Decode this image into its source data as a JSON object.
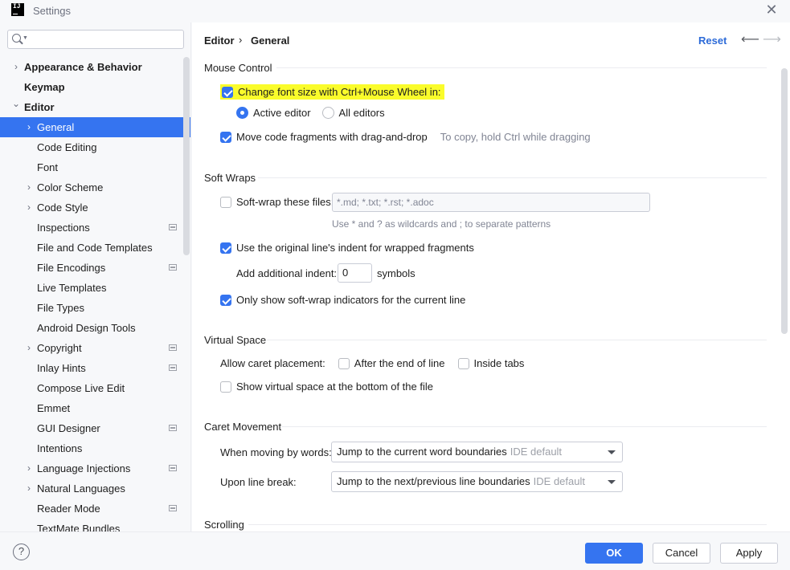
{
  "window": {
    "title": "Settings",
    "logo_text": "IJ"
  },
  "sidebar": {
    "search": {
      "placeholder": ""
    },
    "items": [
      {
        "label": "Appearance & Behavior",
        "expandable": true,
        "bold": true
      },
      {
        "label": "Keymap",
        "bold": true
      },
      {
        "label": "Editor",
        "expanded": true,
        "bold": true
      },
      {
        "label": "General",
        "expandable": true,
        "selected": true
      },
      {
        "label": "Code Editing"
      },
      {
        "label": "Font"
      },
      {
        "label": "Color Scheme",
        "expandable": true
      },
      {
        "label": "Code Style",
        "expandable": true
      },
      {
        "label": "Inspections",
        "project_icon": true
      },
      {
        "label": "File and Code Templates"
      },
      {
        "label": "File Encodings",
        "project_icon": true
      },
      {
        "label": "Live Templates"
      },
      {
        "label": "File Types"
      },
      {
        "label": "Android Design Tools"
      },
      {
        "label": "Copyright",
        "expandable": true,
        "project_icon": true
      },
      {
        "label": "Inlay Hints",
        "project_icon": true
      },
      {
        "label": "Compose Live Edit"
      },
      {
        "label": "Emmet"
      },
      {
        "label": "GUI Designer",
        "project_icon": true
      },
      {
        "label": "Intentions"
      },
      {
        "label": "Language Injections",
        "expandable": true,
        "project_icon": true
      },
      {
        "label": "Natural Languages",
        "expandable": true
      },
      {
        "label": "Reader Mode",
        "project_icon": true
      },
      {
        "label": "TextMate Bundles"
      }
    ]
  },
  "header": {
    "breadcrumb": [
      "Editor",
      "General"
    ],
    "separator": "›",
    "reset_label": "Reset"
  },
  "sections": {
    "mouse_control": {
      "title": "Mouse Control",
      "change_font_size": {
        "label": "Change font size with Ctrl+Mouse Wheel in:",
        "checked": true
      },
      "active_editor": {
        "label": "Active editor",
        "selected": true
      },
      "all_editors": {
        "label": "All editors",
        "selected": false
      },
      "drag_drop": {
        "label": "Move code fragments with drag-and-drop",
        "checked": true,
        "hint": "To copy, hold Ctrl while dragging"
      }
    },
    "soft_wraps": {
      "title": "Soft Wraps",
      "soft_wrap_files": {
        "label": "Soft-wrap these files:",
        "checked": false,
        "value": "*.md; *.txt; *.rst; *.adoc"
      },
      "wildcards_hint": "Use * and ? as wildcards and ; to separate patterns",
      "original_indent": {
        "label": "Use the original line's indent for wrapped fragments",
        "checked": true
      },
      "additional_indent": {
        "label": "Add additional indent:",
        "value": "0",
        "unit": "symbols"
      },
      "indicators": {
        "label": "Only show soft-wrap indicators for the current line",
        "checked": true
      }
    },
    "virtual_space": {
      "title": "Virtual Space",
      "caret_placement_label": "Allow caret placement:",
      "after_end": {
        "label": "After the end of line",
        "checked": false
      },
      "inside_tabs": {
        "label": "Inside tabs",
        "checked": false
      },
      "show_virtual": {
        "label": "Show virtual space at the bottom of the file",
        "checked": false
      }
    },
    "caret_movement": {
      "title": "Caret Movement",
      "words": {
        "label": "When moving by words:",
        "value": "Jump to the current word boundaries",
        "default": "IDE default"
      },
      "line_break": {
        "label": "Upon line break:",
        "value": "Jump to the next/previous line boundaries",
        "default": "IDE default"
      }
    },
    "scrolling": {
      "title": "Scrolling"
    }
  },
  "footer": {
    "help": "?",
    "ok": "OK",
    "cancel": "Cancel",
    "apply": "Apply"
  },
  "colors": {
    "accent": "#3574f0",
    "link": "#2d6bd8",
    "highlight": "#fafc2b"
  }
}
